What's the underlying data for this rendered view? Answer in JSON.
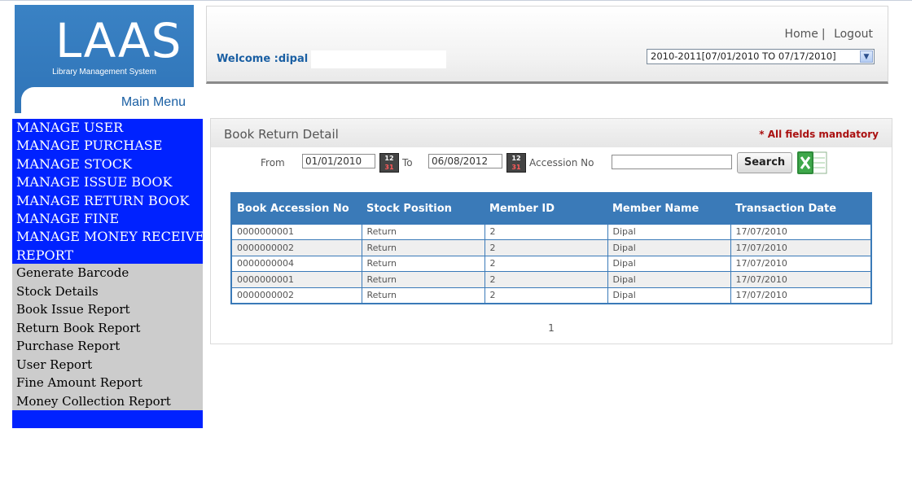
{
  "logo": {
    "text": "LAAS",
    "subtitle": "Library Management System"
  },
  "sidebar": {
    "main_menu_label": "Main Menu",
    "items": [
      {
        "label": "MANAGE USER"
      },
      {
        "label": "MANAGE PURCHASE"
      },
      {
        "label": "MANAGE STOCK"
      },
      {
        "label": "MANAGE ISSUE BOOK"
      },
      {
        "label": "MANAGE RETURN BOOK"
      },
      {
        "label": "MANAGE FINE"
      },
      {
        "label": "MANAGE MONEY RECEIVE"
      },
      {
        "label": "REPORT"
      }
    ],
    "reports": [
      {
        "label": "Generate Barcode"
      },
      {
        "label": "Stock Details"
      },
      {
        "label": "Book Issue Report"
      },
      {
        "label": "Return Book Report"
      },
      {
        "label": "Purchase Report"
      },
      {
        "label": "User Report"
      },
      {
        "label": "Fine Amount Report"
      },
      {
        "label": "Money Collection Report"
      }
    ]
  },
  "header": {
    "welcome": "Welcome :dipal",
    "home_link": "Home",
    "separator": "|",
    "logout_link": "Logout",
    "session_selected": "2010-2011[07/01/2010 TO 07/17/2010]"
  },
  "panel": {
    "title": "Book Return Detail",
    "mandatory_note": "* All fields mandatory"
  },
  "filters": {
    "from_label": "From",
    "from_value": "01/01/2010",
    "to_label": "To",
    "to_value": "06/08/2012",
    "accession_label": "Accession No",
    "accession_value": "",
    "search_label": "Search",
    "calendar_icon_text_top": "12",
    "calendar_icon_text_bottom": "31"
  },
  "table": {
    "columns": [
      "Book Accession No",
      "Stock Position",
      "Member ID",
      "Member Name",
      "Transaction Date"
    ],
    "rows": [
      [
        "0000000001",
        "Return",
        "2",
        "Dipal",
        "17/07/2010"
      ],
      [
        "0000000002",
        "Return",
        "2",
        "Dipal",
        "17/07/2010"
      ],
      [
        "0000000004",
        "Return",
        "2",
        "Dipal",
        "17/07/2010"
      ],
      [
        "0000000001",
        "Return",
        "2",
        "Dipal",
        "17/07/2010"
      ],
      [
        "0000000002",
        "Return",
        "2",
        "Dipal",
        "17/07/2010"
      ]
    ]
  },
  "pager": {
    "current": "1"
  },
  "colors": {
    "sidebar_blue": "#0022ff",
    "header_blue": "#3a7ab8",
    "logo_blue": "#3a82c4",
    "mandatory_red": "#aa1111"
  }
}
